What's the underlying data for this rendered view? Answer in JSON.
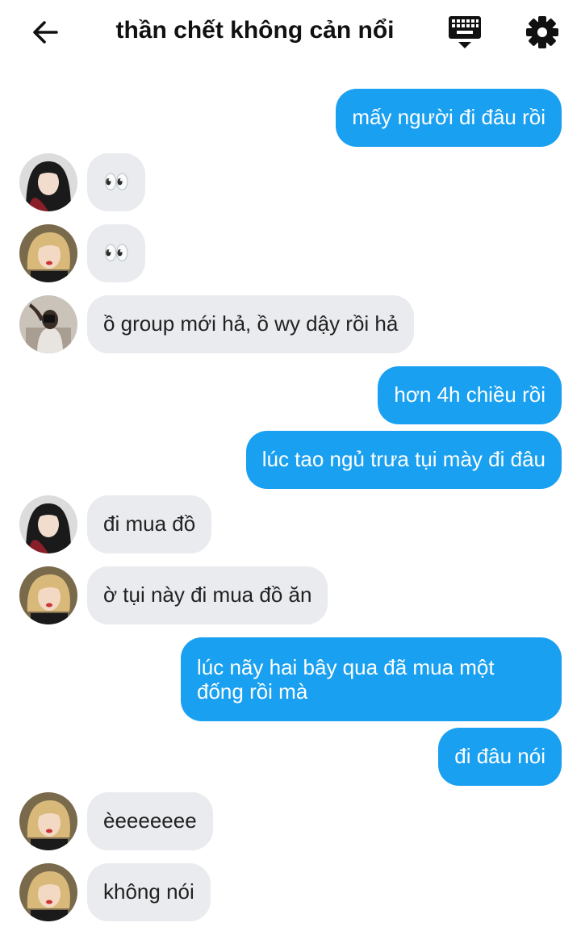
{
  "header": {
    "title": "thần chết không cản nổi",
    "back_icon": "arrow-left-icon",
    "keyboard_icon": "keyboard-hide-icon",
    "settings_icon": "gear-icon"
  },
  "colors": {
    "outgoing_bubble": "#1aa0f0",
    "incoming_bubble": "#e9ebee",
    "outgoing_text": "#ffffff",
    "incoming_text": "#222222"
  },
  "messages": [
    {
      "direction": "out",
      "text": "mấy người đi đâu rồi"
    },
    {
      "direction": "in",
      "avatar": "avatar-dark-hair",
      "text": "👀"
    },
    {
      "direction": "in",
      "avatar": "avatar-blonde",
      "text": "👀"
    },
    {
      "direction": "in",
      "avatar": "avatar-mirror-selfie",
      "text": "ồ group mới hả, ồ wy dậy rồi hả"
    },
    {
      "direction": "out",
      "text": "hơn 4h chiều rồi"
    },
    {
      "direction": "out",
      "text": "lúc tao ngủ trưa tụi mày đi đâu"
    },
    {
      "direction": "in",
      "avatar": "avatar-dark-hair",
      "text": "đi mua đồ"
    },
    {
      "direction": "in",
      "avatar": "avatar-blonde",
      "text": "ờ tụi này đi mua đồ ăn"
    },
    {
      "direction": "out",
      "text": "lúc nãy hai bây qua đã mua một đống rồi mà"
    },
    {
      "direction": "out",
      "text": "đi đâu nói"
    },
    {
      "direction": "in",
      "avatar": "avatar-blonde",
      "text": "èeeeeeee"
    },
    {
      "direction": "in",
      "avatar": "avatar-blonde",
      "text": "không nói"
    }
  ]
}
